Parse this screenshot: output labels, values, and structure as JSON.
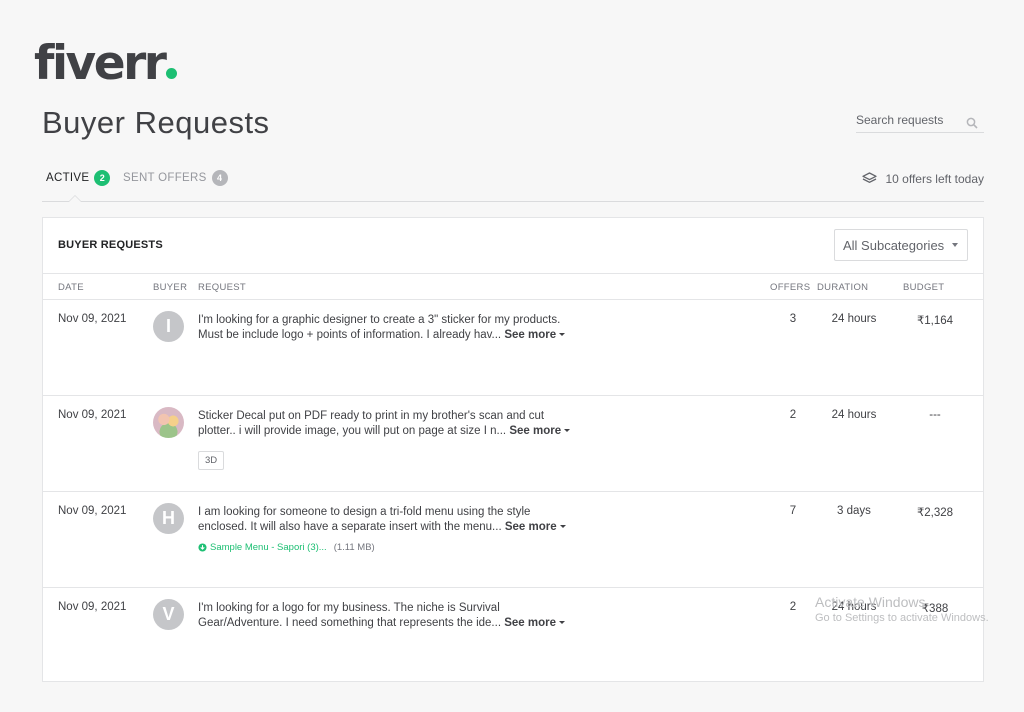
{
  "brand": {
    "logo_text": "fiverr",
    "accent": "#1dbf73"
  },
  "page": {
    "title": "Buyer Requests"
  },
  "search": {
    "placeholder": "Search requests",
    "icon": "search-icon"
  },
  "tabs": [
    {
      "label": "ACTIVE",
      "count": "2",
      "active": true
    },
    {
      "label": "SENT OFFERS",
      "count": "4",
      "active": false
    }
  ],
  "offers_left": {
    "icon": "layers-icon",
    "text": "10 offers left today"
  },
  "panel": {
    "title": "BUYER REQUESTS",
    "subcategory_select": "All Subcategories"
  },
  "columns": {
    "date": "DATE",
    "buyer": "BUYER",
    "request": "REQUEST",
    "offers": "OFFERS",
    "duration": "DURATION",
    "budget": "BUDGET"
  },
  "rows": [
    {
      "date": "Nov 09, 2021",
      "buyer_initial": "I",
      "request_line1": "I'm looking for a graphic designer to create a 3\" sticker for my products.",
      "request_line2": "Must be include logo + points of information. I already hav...",
      "see_more": "See more",
      "offers": "3",
      "duration": "24 hours",
      "budget": "₹1,164"
    },
    {
      "date": "Nov 09, 2021",
      "buyer_initial": "",
      "request_line1": "Sticker Decal put on PDF ready to print in my brother's scan and cut",
      "request_line2": "plotter.. i will provide image, you will put on page at size I n...",
      "see_more": "See more",
      "tag": "3D",
      "offers": "2",
      "duration": "24 hours",
      "budget": "---"
    },
    {
      "date": "Nov 09, 2021",
      "buyer_initial": "H",
      "request_line1": "I am looking for someone to design a tri-fold menu using the style",
      "request_line2": "enclosed. It will also have a separate insert with the menu...",
      "see_more": "See more",
      "attachment_name": "Sample Menu - Sapori (3)...",
      "attachment_size": "(1.11 MB)",
      "offers": "7",
      "duration": "3 days",
      "budget": "₹2,328"
    },
    {
      "date": "Nov 09, 2021",
      "buyer_initial": "V",
      "request_line1": "I'm looking for a logo for my business. The niche is Survival",
      "request_line2": "Gear/Adventure. I need something that represents the ide...",
      "see_more": "See more",
      "offers": "2",
      "duration": "24 hours",
      "budget": "₹388"
    }
  ],
  "watermark": {
    "line1": "Activate Windows",
    "line2": "Go to Settings to activate Windows."
  }
}
